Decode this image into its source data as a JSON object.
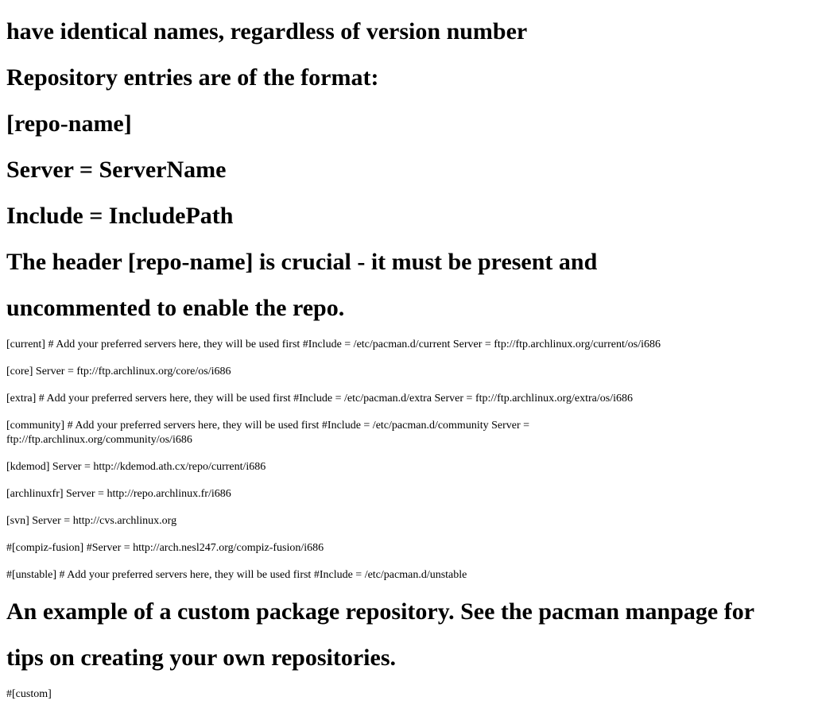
{
  "headings_top": [
    "have identical names, regardless of version number",
    "Repository entries are of the format:",
    "[repo-name]",
    "Server = ServerName",
    "Include = IncludePath",
    "The header [repo-name] is crucial - it must be present and",
    "uncommented to enable the repo."
  ],
  "config_lines": [
    "[current] # Add your preferred servers here, they will be used first #Include = /etc/pacman.d/current Server = ftp://ftp.archlinux.org/current/os/i686",
    "[core] Server = ftp://ftp.archlinux.org/core/os/i686",
    "[extra] # Add your preferred servers here, they will be used first #Include = /etc/pacman.d/extra Server = ftp://ftp.archlinux.org/extra/os/i686",
    "[community] # Add your preferred servers here, they will be used first #Include = /etc/pacman.d/community Server = ftp://ftp.archlinux.org/community/os/i686",
    "[kdemod] Server = http://kdemod.ath.cx/repo/current/i686",
    "[archlinuxfr] Server = http://repo.archlinux.fr/i686",
    "[svn] Server = http://cvs.archlinux.org",
    "#[compiz-fusion] #Server = http://arch.nesl247.org/compiz-fusion/i686",
    "#[unstable] # Add your preferred servers here, they will be used first #Include = /etc/pacman.d/unstable"
  ],
  "headings_bottom": [
    "An example of a custom package repository. See the pacman manpage for",
    "tips on creating your own repositories."
  ],
  "footer_line": "#[custom]"
}
